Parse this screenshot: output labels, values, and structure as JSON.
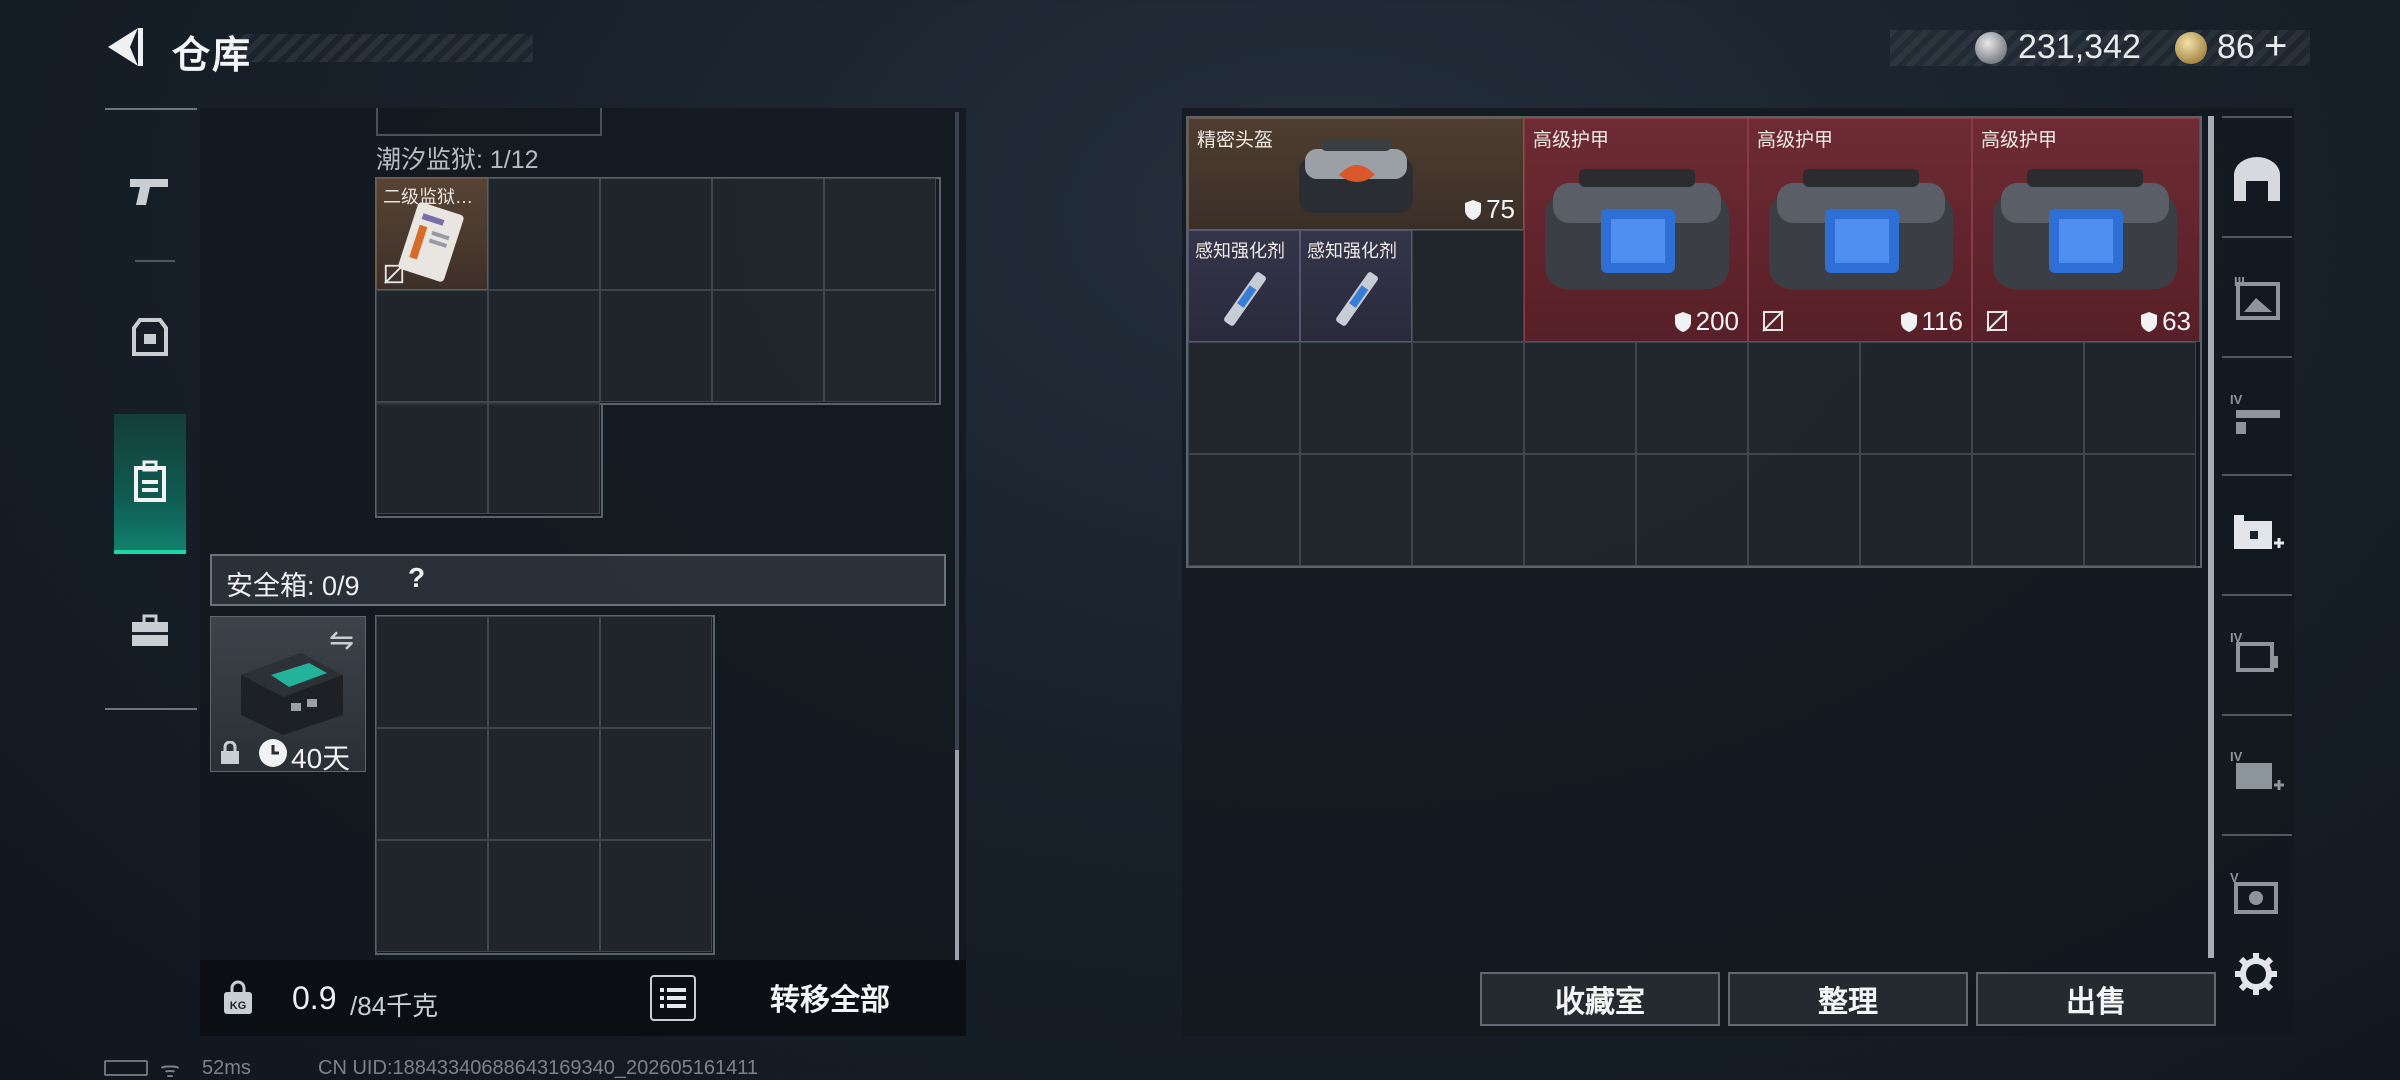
{
  "header": {
    "title": "仓库"
  },
  "currency": {
    "silver_value": "231,342",
    "gold_value": "86",
    "plus_label": "+"
  },
  "backpack": {
    "sub_container_label": "潮汐监狱: 1/12",
    "prison_item_name": "二级监狱…",
    "safe_box_label": "安全箱: 0/9",
    "help_label": "?",
    "safe_box_days": "40天",
    "weight_current": "0.9",
    "weight_max": "/84千克",
    "weight_icon_label": "KG",
    "transfer_all_label": "转移全部"
  },
  "storage": {
    "items": [
      {
        "name": "精密头盔",
        "durability": "75",
        "rarity": "brown"
      },
      {
        "name": "感知强化剂",
        "rarity": "blue"
      },
      {
        "name": "感知强化剂",
        "rarity": "blue"
      },
      {
        "name": "高级护甲",
        "durability": "200",
        "rarity": "red"
      },
      {
        "name": "高级护甲",
        "durability": "116",
        "rarity": "red"
      },
      {
        "name": "高级护甲",
        "durability": "63",
        "rarity": "red"
      }
    ],
    "buttons": {
      "collection": "收藏室",
      "organize": "整理",
      "sell": "出售"
    }
  },
  "right_nav": {
    "tiers": [
      "III",
      "IV",
      "IV",
      "IV",
      "V"
    ]
  },
  "status_bar": {
    "ping": "52ms",
    "uid": "CN UID:18843340688643169340_202605161411"
  },
  "colors": {
    "accent": "#1fd6a6",
    "rarity_red": "#6e2b33",
    "rarity_brown": "#4f3e31",
    "rarity_blue": "#35354a"
  }
}
